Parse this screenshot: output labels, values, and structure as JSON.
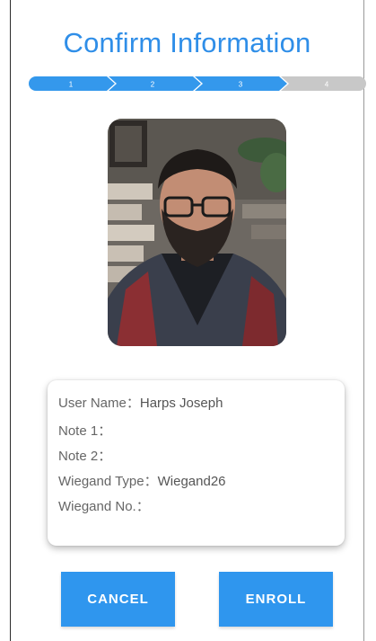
{
  "page": {
    "title": "Confirm Information"
  },
  "steps": [
    {
      "label": "1",
      "state": "done"
    },
    {
      "label": "2",
      "state": "done"
    },
    {
      "label": "3",
      "state": "active"
    },
    {
      "label": "4",
      "state": "pending"
    }
  ],
  "colors": {
    "accent": "#2f8ee8",
    "step_active": "#3498ec",
    "step_pending": "#c8c8c8",
    "button": "#2f96ee"
  },
  "photo": {
    "icon": "user-photo"
  },
  "info": {
    "user_name_label": "User Name：",
    "user_name_value": "Harps Joseph",
    "note1_label": "Note 1：",
    "note1_value": "",
    "note2_label": "Note 2：",
    "note2_value": "",
    "wiegand_type_label": "Wiegand Type：",
    "wiegand_type_value": "Wiegand26",
    "wiegand_no_label": "Wiegand No.：",
    "wiegand_no_value": ""
  },
  "buttons": {
    "cancel": "CANCEL",
    "enroll": "ENROLL"
  }
}
